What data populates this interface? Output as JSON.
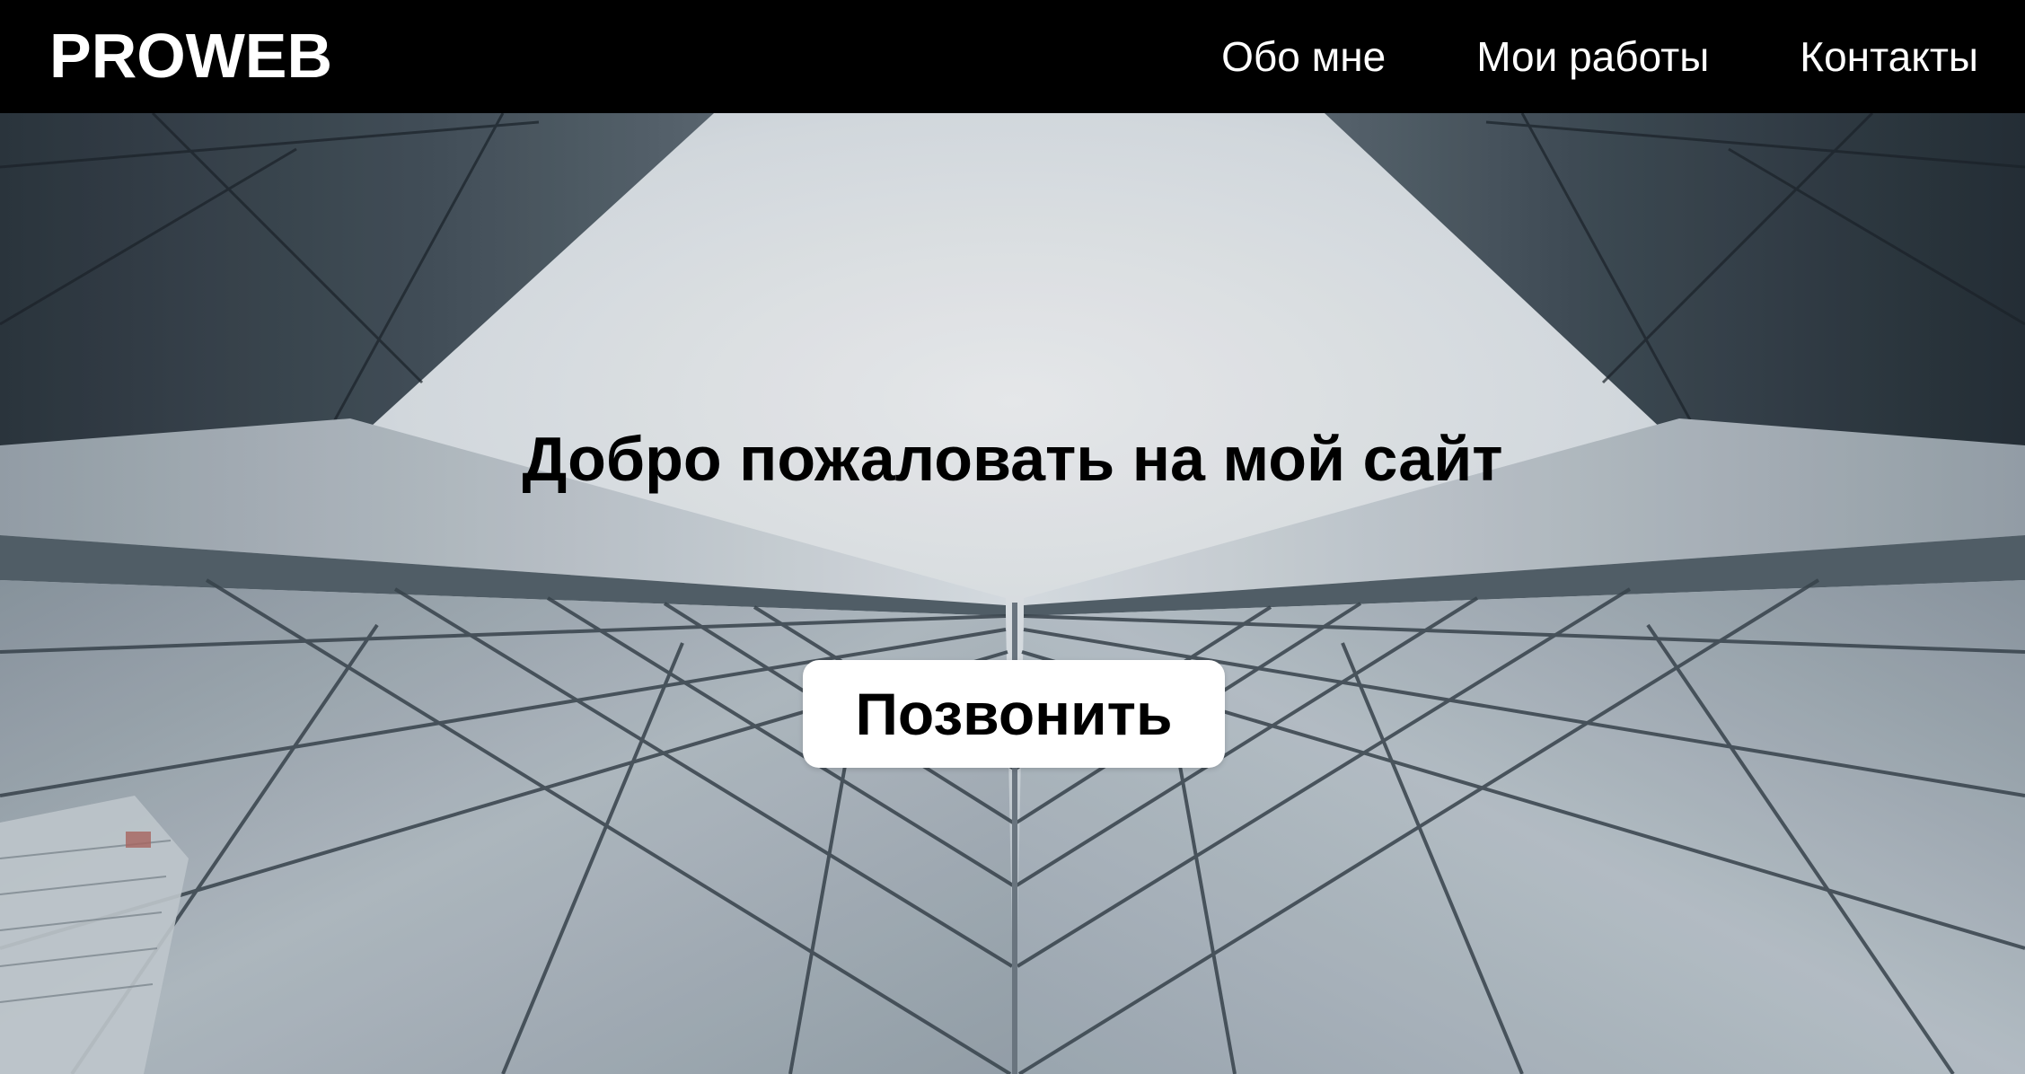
{
  "header": {
    "logo": "PROWEB",
    "nav": [
      {
        "label": "Обо мне"
      },
      {
        "label": "Мои работы"
      },
      {
        "label": "Контакты"
      }
    ]
  },
  "hero": {
    "title": "Добро пожаловать на мой сайт",
    "button_label": "Позвонить",
    "background": "looking-up-between-glass-skyscrapers-photo"
  },
  "colors": {
    "header_bg": "#000000",
    "header_text": "#ffffff",
    "hero_title": "#000000",
    "button_bg": "#ffffff",
    "button_text": "#000000"
  }
}
